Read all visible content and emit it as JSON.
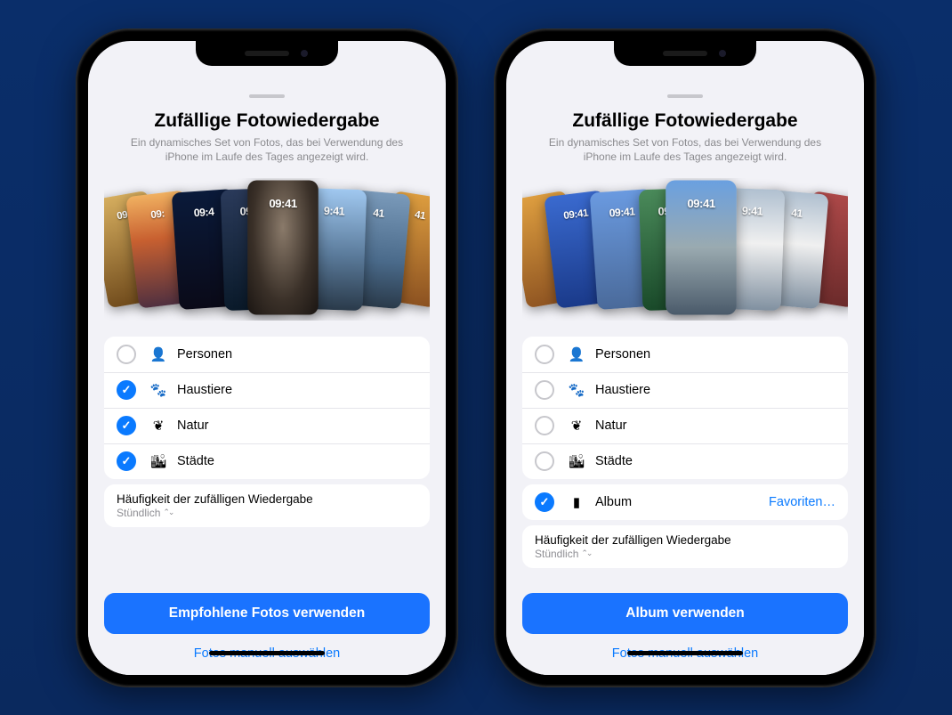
{
  "screens": [
    {
      "title": "Zufällige Fotowiedergabe",
      "subtitle": "Ein dynamisches Set von Fotos, das bei Verwendung des iPhone im Laufe des Tages angezeigt wird.",
      "strip_time_samples": [
        "09",
        "09:",
        "09:4",
        "09:41",
        "09:41",
        "9:41",
        "41",
        "41"
      ],
      "categories": [
        {
          "icon": "person-icon",
          "glyph": "👤",
          "label": "Personen",
          "selected": false
        },
        {
          "icon": "paw-icon",
          "glyph": "🐾",
          "label": "Haustiere",
          "selected": true
        },
        {
          "icon": "leaf-icon",
          "glyph": "❦",
          "label": "Natur",
          "selected": true
        },
        {
          "icon": "city-icon",
          "glyph": "🏙",
          "label": "Städte",
          "selected": true
        }
      ],
      "frequency": {
        "label": "Häufigkeit der zufälligen Wiedergabe",
        "value": "Stündlich"
      },
      "primary_button": "Empfohlene Fotos verwenden",
      "secondary_link": "Fotos manuell auswählen"
    },
    {
      "title": "Zufällige Fotowiedergabe",
      "subtitle": "Ein dynamisches Set von Fotos, das bei Verwendung des iPhone im Laufe des Tages angezeigt wird.",
      "strip_time_samples": [
        "09:41",
        "09:41",
        "09:41",
        "09:41",
        "9:41",
        "41",
        "",
        ""
      ],
      "categories": [
        {
          "icon": "person-icon",
          "glyph": "👤",
          "label": "Personen",
          "selected": false
        },
        {
          "icon": "paw-icon",
          "glyph": "🐾",
          "label": "Haustiere",
          "selected": false
        },
        {
          "icon": "leaf-icon",
          "glyph": "❦",
          "label": "Natur",
          "selected": false
        },
        {
          "icon": "city-icon",
          "glyph": "🏙",
          "label": "Städte",
          "selected": false
        }
      ],
      "album_row": {
        "icon": "album-icon",
        "glyph": "▮",
        "label": "Album",
        "value": "Favoriten…",
        "selected": true
      },
      "frequency": {
        "label": "Häufigkeit der zufälligen Wiedergabe",
        "value": "Stündlich"
      },
      "primary_button": "Album verwenden",
      "secondary_link": "Fotos manuell auswählen"
    }
  ]
}
